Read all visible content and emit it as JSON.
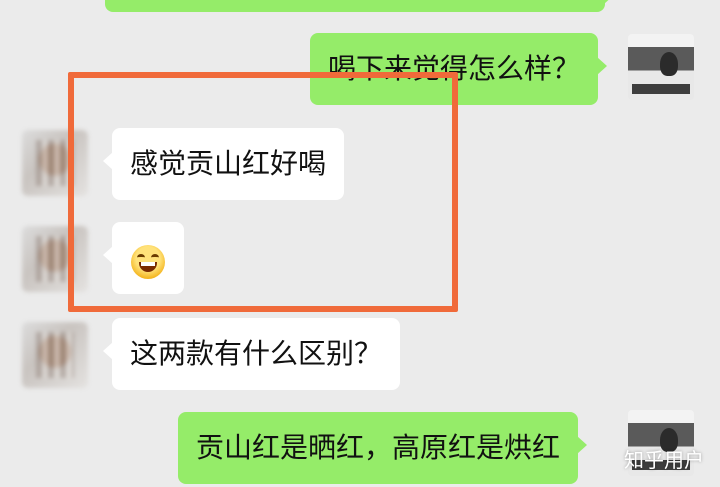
{
  "messages": [
    {
      "text": "喝下来觉得怎么样？",
      "side": "right"
    },
    {
      "text": "感觉贡山红好喝",
      "side": "left"
    },
    {
      "emoji": "grinning-squint-emoji",
      "side": "left"
    },
    {
      "text": "这两款有什么区别？",
      "side": "left"
    },
    {
      "text": "贡山红是晒红，高原红是烘红",
      "side": "right"
    }
  ],
  "watermark": "知乎用户",
  "colors": {
    "sent_bubble": "#95ec69",
    "received_bubble": "#ffffff",
    "highlight_box": "#f06a3a",
    "background": "#ebebeb"
  }
}
